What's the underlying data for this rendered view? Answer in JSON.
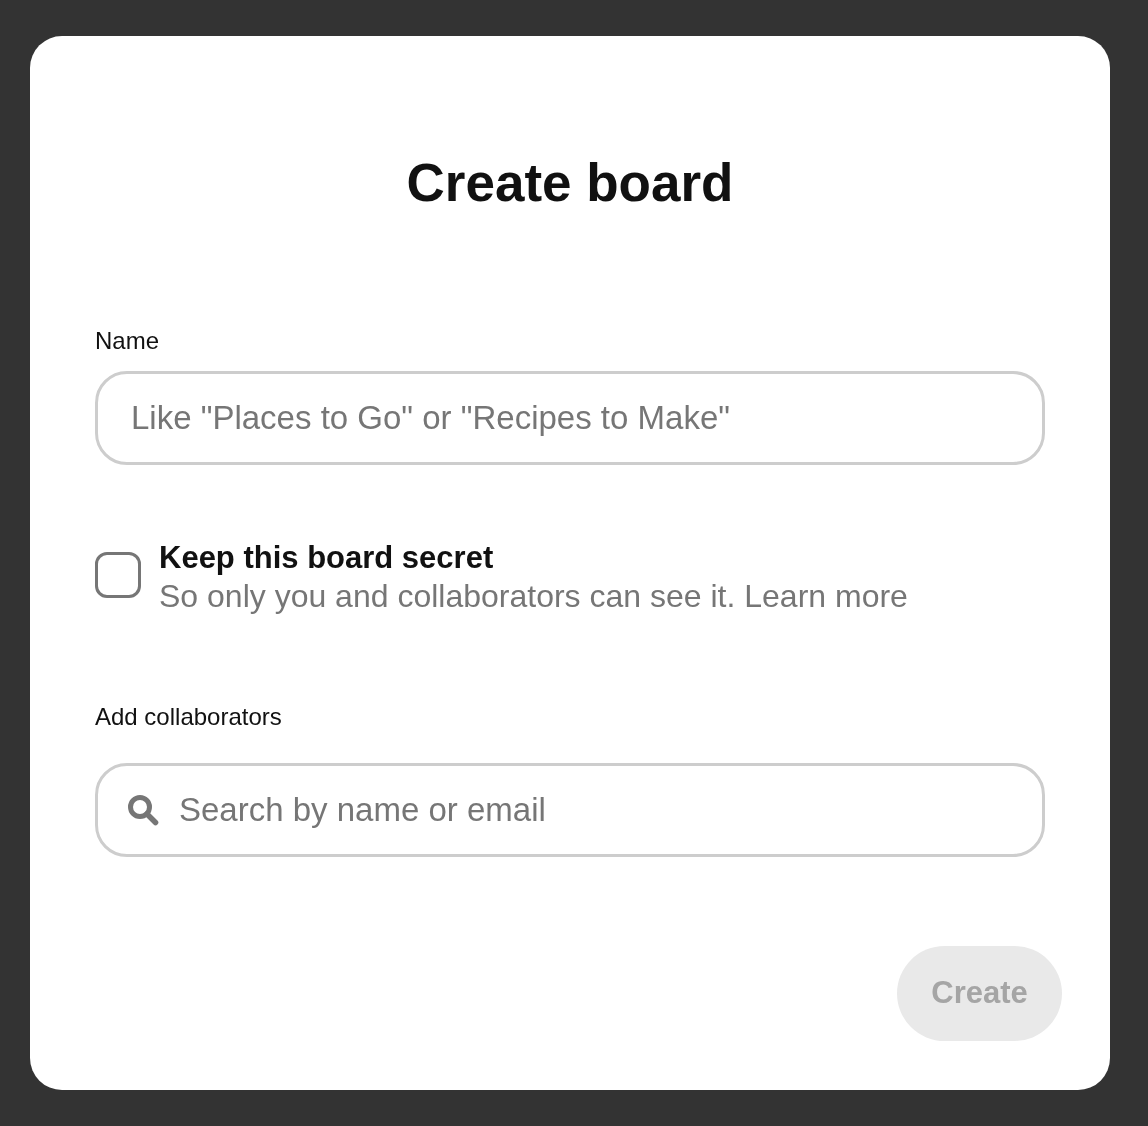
{
  "dialog": {
    "title": "Create board",
    "name_field": {
      "label": "Name",
      "placeholder": "Like \"Places to Go\" or \"Recipes to Make\""
    },
    "secret_option": {
      "checked": false,
      "title": "Keep this board secret",
      "description": "So only you and collaborators can see it.",
      "link": "Learn more"
    },
    "collaborators_field": {
      "label": "Add collaborators",
      "placeholder": "Search by name or email"
    },
    "create_button": {
      "label": "Create",
      "disabled": true
    }
  }
}
